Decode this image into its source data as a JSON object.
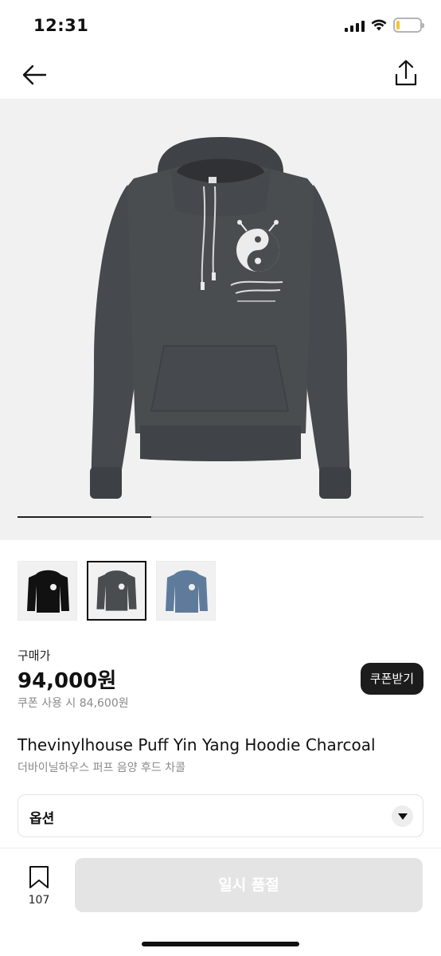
{
  "status_bar": {
    "time": "12:31",
    "icons": [
      "signal-icon",
      "wifi-icon",
      "battery-icon"
    ],
    "battery_level": 0.15,
    "battery_color": "#f4c430"
  },
  "nav": {
    "back_icon": "arrow-left-icon",
    "share_icon": "share-icon"
  },
  "gallery": {
    "image_progress": 0.33,
    "thumbnails": [
      {
        "name": "black-hoodie",
        "color": "#111111",
        "selected": false
      },
      {
        "name": "charcoal-hoodie",
        "color": "#4a4d50",
        "selected": true
      },
      {
        "name": "blue-hoodie",
        "color": "#5f7b9c",
        "selected": false
      }
    ]
  },
  "product": {
    "price_label": "구매가",
    "price": "94,000원",
    "coupon_price": "쿠폰 사용 시 84,600원",
    "coupon_button": "쿠폰받기",
    "title_en": "Thevinylhouse Puff Yin Yang Hoodie Charcoal",
    "title_ko": "더바이닐하우스 퍼프 음양 후드 차콜"
  },
  "options": {
    "label": "옵션"
  },
  "bottom_bar": {
    "bookmark_count": "107",
    "buy_label": "일시 품절"
  },
  "colors": {
    "accent_dark": "#1c1c1c",
    "disabled_button": "#e4e4e4",
    "hoodie_charcoal": "#4a4d50"
  }
}
